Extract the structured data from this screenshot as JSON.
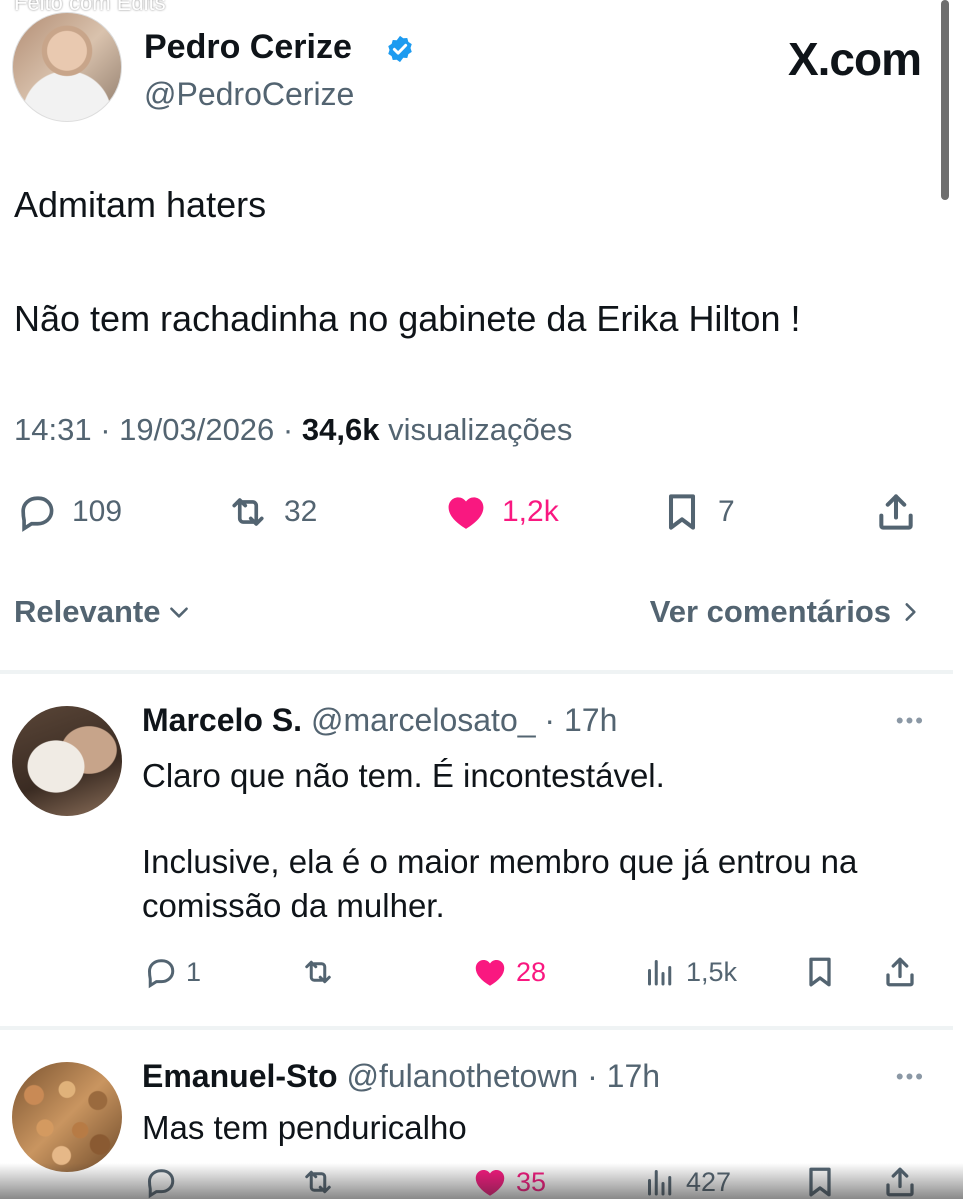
{
  "watermark": "Feito com Edits",
  "header": {
    "author_name": "Pedro Cerize",
    "author_handle": "@PedroCerize",
    "site_logo": "X.com"
  },
  "tweet": {
    "line1": "Admitam haters",
    "line2": "Não tem rachadinha no gabinete da Erika Hilton !",
    "time": "14:31",
    "date": "19/03/2026",
    "views_count": "34,6k",
    "views_label": "visualizações"
  },
  "actions": {
    "replies": "109",
    "retweets": "32",
    "likes": "1,2k",
    "bookmarks": "7"
  },
  "sort": {
    "left_label": "Relevante",
    "right_label": "Ver comentários"
  },
  "replies": [
    {
      "name": "Marcelo S.",
      "handle": "@marcelosato_",
      "time": "17h",
      "text1": "Claro que não tem. É incontestável.",
      "text2": "Inclusive, ela é o maior membro que já entrou na comissão da mulher.",
      "reply_count": "1",
      "like_count": "28",
      "view_count": "1,5k"
    },
    {
      "name": "Emanuel-Sto",
      "handle": "@fulanothetown",
      "time": "17h",
      "text1": "Mas tem penduricalho",
      "like_count": "35",
      "view_count": "427"
    }
  ],
  "colors": {
    "like": "#f91880",
    "muted": "#536471",
    "text": "#0f1419",
    "verified": "#1d9bf0"
  }
}
